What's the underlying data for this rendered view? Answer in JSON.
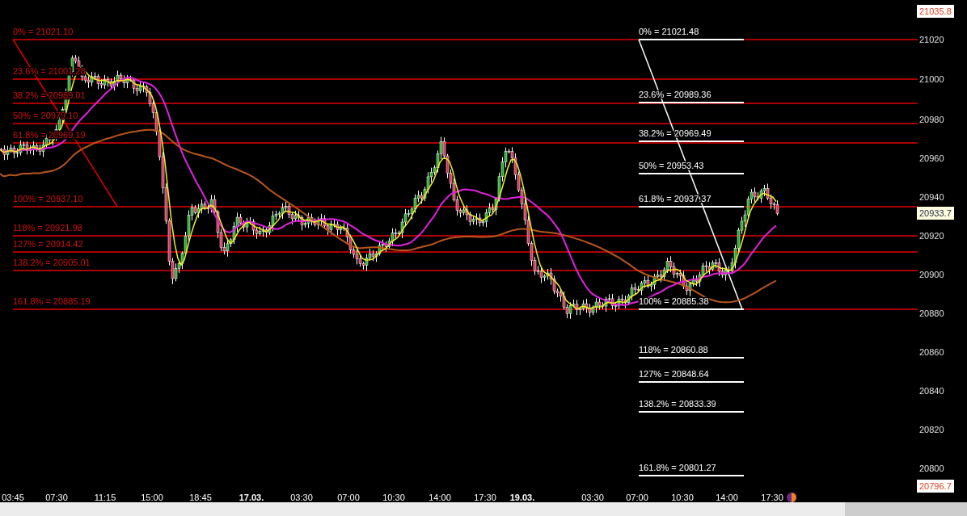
{
  "chart": {
    "price_markers": [
      {
        "kind": "high",
        "text": "21035.8"
      },
      {
        "kind": "last",
        "text": "20933.7"
      },
      {
        "kind": "low",
        "text": "20796.7"
      }
    ],
    "price_axis": {
      "ticks": [
        "21020",
        "21000",
        "20980",
        "20960",
        "20940",
        "20920",
        "20900",
        "20880",
        "20860",
        "20840",
        "20820",
        "20800"
      ]
    },
    "time_axis": {
      "labels": [
        {
          "text": "03:45",
          "bold": false
        },
        {
          "text": "07:30",
          "bold": false
        },
        {
          "text": "11:15",
          "bold": false
        },
        {
          "text": "15:00",
          "bold": false
        },
        {
          "text": "18:45",
          "bold": false
        },
        {
          "text": "17.03.",
          "bold": true
        },
        {
          "text": "03:30",
          "bold": false
        },
        {
          "text": "07:00",
          "bold": false
        },
        {
          "text": "10:30",
          "bold": false
        },
        {
          "text": "14:00",
          "bold": false
        },
        {
          "text": "17:30",
          "bold": false
        },
        {
          "text": "19.03.",
          "bold": true
        },
        {
          "text": "03:30",
          "bold": false
        },
        {
          "text": "07:00",
          "bold": false
        },
        {
          "text": "10:30",
          "bold": false
        },
        {
          "text": "14:00",
          "bold": false
        },
        {
          "text": "17:30",
          "bold": false
        }
      ]
    },
    "fibonacci_sets": [
      {
        "color": "#e00000",
        "levels": [
          "0% = 21021.10",
          "23.6% = 21001.28",
          "38.2% = 20989.01",
          "50% = 20979.10",
          "61.8% = 20969.19",
          "100% = 20937.10",
          "118% = 20921.98",
          "127% = 20914.42",
          "138.2% = 20905.01",
          "161.8% = 20885.19"
        ]
      },
      {
        "color": "#ffffff",
        "levels": [
          "0% = 21021.48",
          "23.6% = 20989.36",
          "38.2% = 20969.49",
          "50% = 20953.43",
          "61.8% = 20937.37",
          "100% = 20885.38",
          "118% = 20860.88",
          "127% = 20848.64",
          "138.2% = 20833.39",
          "161.8% = 20801.27"
        ]
      }
    ]
  }
}
